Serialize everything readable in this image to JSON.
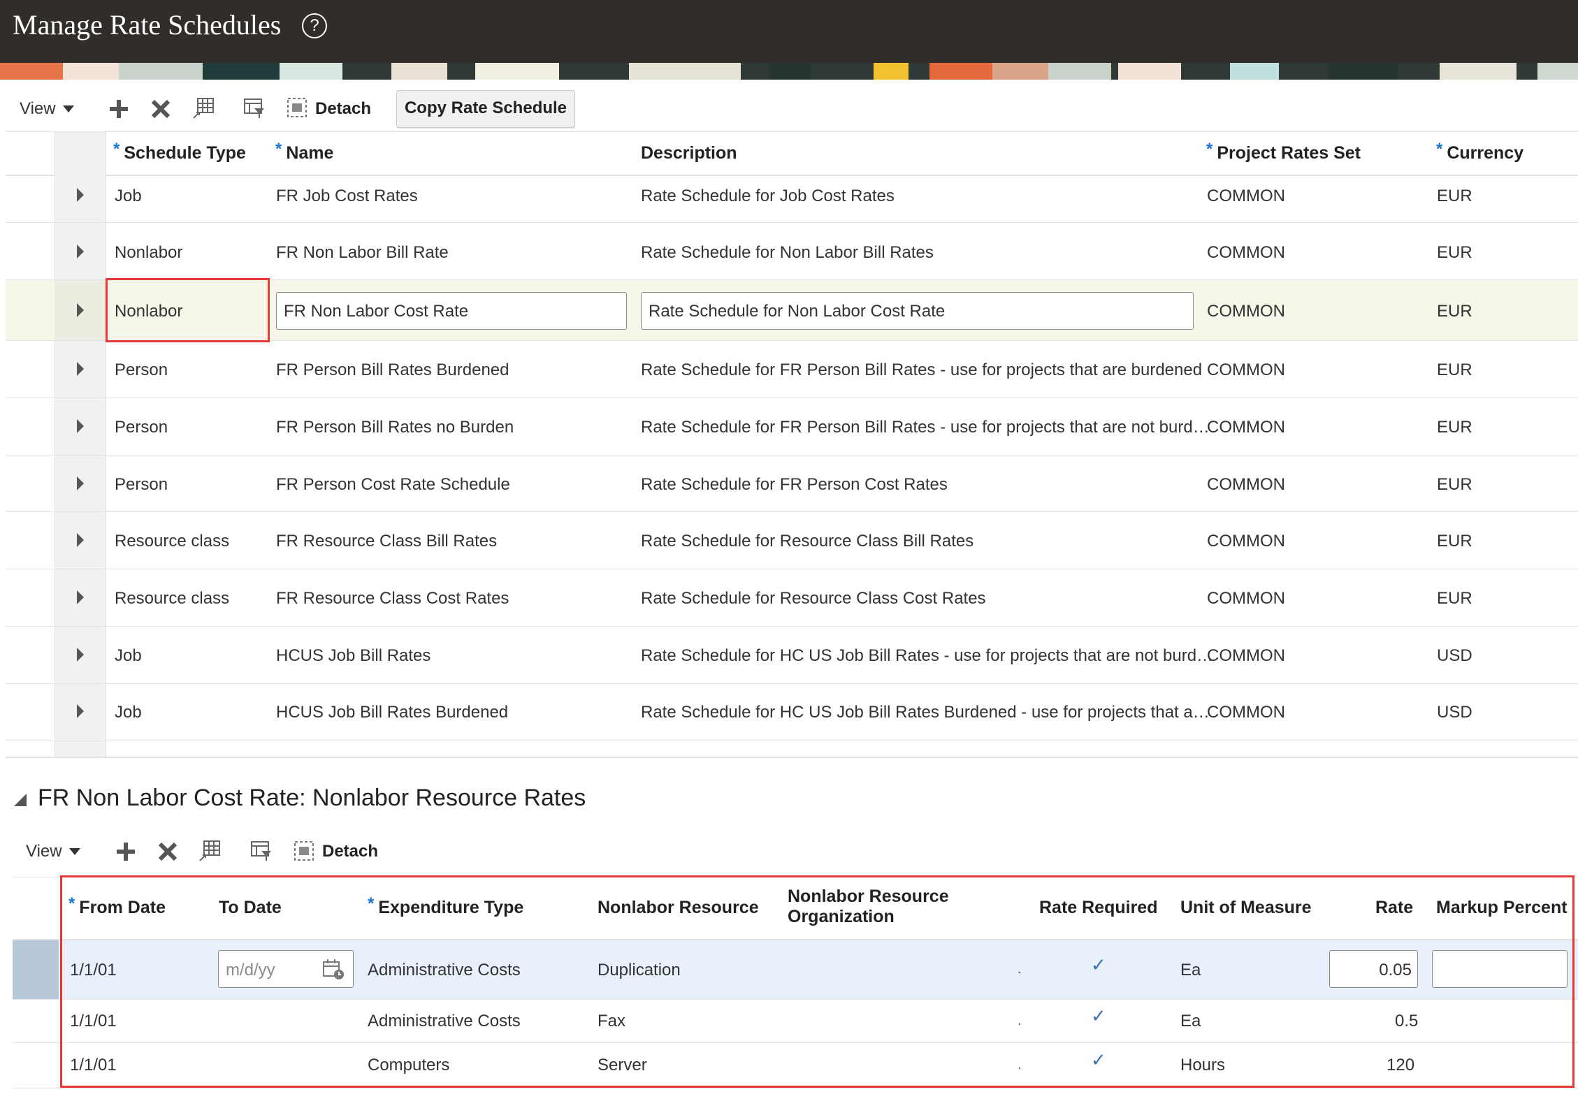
{
  "page": {
    "title": "Manage Rate Schedules"
  },
  "toolbar": {
    "view_label": "View",
    "detach_label": "Detach",
    "copy_label": "Copy Rate Schedule"
  },
  "schedules": {
    "columns": {
      "schedule_type": "Schedule Type",
      "name": "Name",
      "description": "Description",
      "rates_set": "Project Rates Set",
      "currency": "Currency"
    },
    "rows": [
      {
        "type": "Job",
        "name": "FR Job Cost Rates",
        "description": "Rate Schedule for Job Cost Rates",
        "rates_set": "COMMON",
        "currency": "EUR"
      },
      {
        "type": "Nonlabor",
        "name": "FR Non Labor Bill Rate",
        "description": "Rate Schedule for Non Labor Bill Rates",
        "rates_set": "COMMON",
        "currency": "EUR"
      },
      {
        "type": "Nonlabor",
        "name": "FR Non Labor Cost Rate",
        "description": "Rate Schedule for Non Labor Cost Rate",
        "rates_set": "COMMON",
        "currency": "EUR"
      },
      {
        "type": "Person",
        "name": "FR Person Bill Rates Burdened",
        "description": "Rate Schedule for FR Person Bill Rates - use for projects that are burdened",
        "rates_set": "COMMON",
        "currency": "EUR"
      },
      {
        "type": "Person",
        "name": "FR Person Bill Rates no Burden",
        "description": "Rate Schedule for FR Person Bill Rates - use for projects that are not burd…",
        "rates_set": "COMMON",
        "currency": "EUR"
      },
      {
        "type": "Person",
        "name": "FR Person Cost Rate Schedule",
        "description": "Rate Schedule for FR Person Cost Rates",
        "rates_set": "COMMON",
        "currency": "EUR"
      },
      {
        "type": "Resource class",
        "name": "FR Resource Class Bill Rates",
        "description": "Rate Schedule for Resource Class Bill Rates",
        "rates_set": "COMMON",
        "currency": "EUR"
      },
      {
        "type": "Resource class",
        "name": "FR Resource Class Cost Rates",
        "description": "Rate Schedule for Resource Class Cost Rates",
        "rates_set": "COMMON",
        "currency": "EUR"
      },
      {
        "type": "Job",
        "name": "HCUS Job Bill Rates",
        "description": "Rate Schedule for HC US Job Bill Rates - use for projects that are not burd…",
        "rates_set": "COMMON",
        "currency": "USD"
      },
      {
        "type": "Job",
        "name": "HCUS Job Bill Rates Burdened",
        "description": "Rate Schedule for HC US Job Bill Rates Burdened - use for projects that a…",
        "rates_set": "COMMON",
        "currency": "USD"
      }
    ]
  },
  "detail": {
    "title": "FR Non Labor Cost Rate: Nonlabor Resource Rates",
    "view_label": "View",
    "detach_label": "Detach",
    "columns": {
      "from_date": "From Date",
      "to_date": "To Date",
      "expenditure_type": "Expenditure Type",
      "nonlabor_resource": "Nonlabor Resource",
      "org_line1": "Nonlabor Resource",
      "org_line2": "Organization",
      "rate_required": "Rate Required",
      "uom": "Unit of Measure",
      "rate": "Rate",
      "markup": "Markup Percent"
    },
    "to_date_placeholder": "m/d/yy",
    "rows": [
      {
        "from": "1/1/01",
        "expenditure": "Administrative Costs",
        "resource": "Duplication",
        "org": ".",
        "required": "✓",
        "uom": "Ea",
        "rate": "0.05"
      },
      {
        "from": "1/1/01",
        "expenditure": "Administrative Costs",
        "resource": "Fax",
        "org": ".",
        "required": "✓",
        "uom": "Ea",
        "rate": "0.5"
      },
      {
        "from": "1/1/01",
        "expenditure": "Computers",
        "resource": "Server",
        "org": ".",
        "required": "✓",
        "uom": "Hours",
        "rate": "120"
      }
    ]
  }
}
